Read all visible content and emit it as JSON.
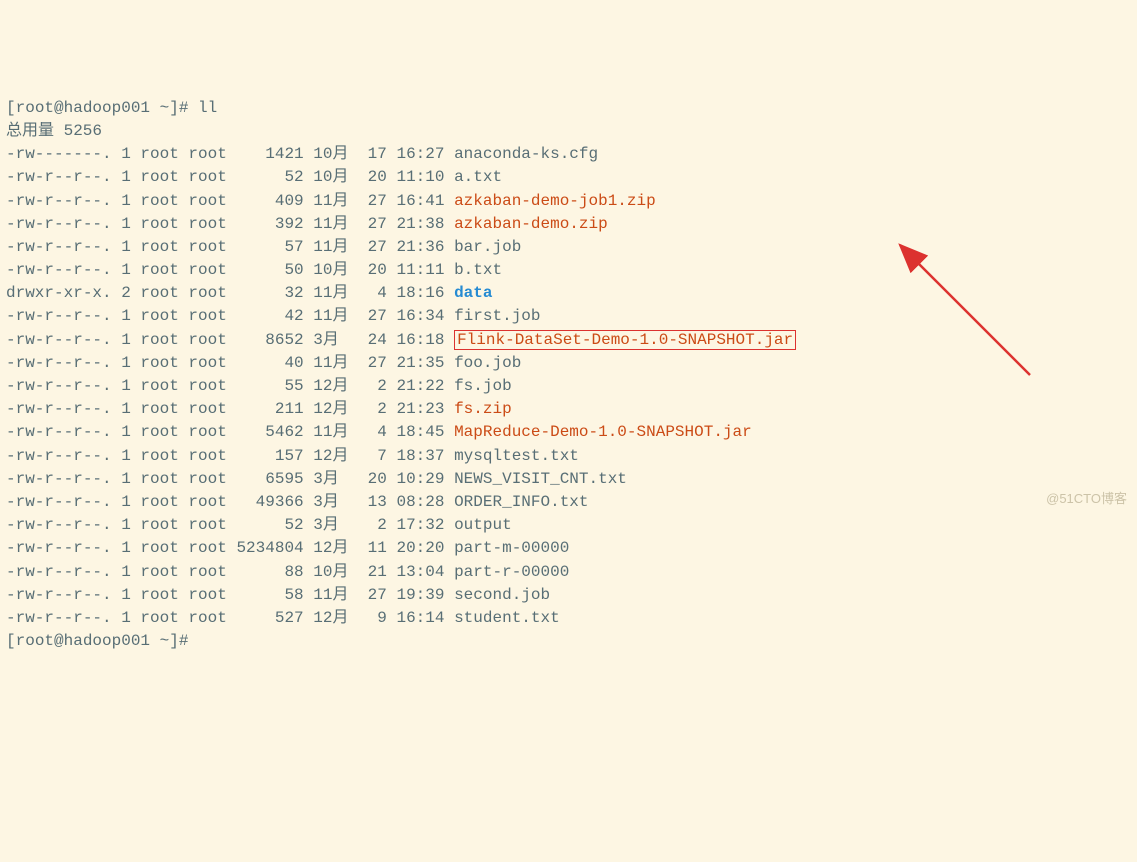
{
  "prompt": {
    "open": "[",
    "user_host": "root@hadoop001 ~",
    "close": "]#",
    "command": "ll"
  },
  "total_line": "总用量 5256",
  "rows": [
    {
      "perm": "-rw-------.",
      "links": "1",
      "owner": "root",
      "group": "root",
      "size": "1421",
      "month": "10月",
      "day": "17",
      "time": "16:27",
      "name": "anaconda-ks.cfg",
      "cls": "fname"
    },
    {
      "perm": "-rw-r--r--.",
      "links": "1",
      "owner": "root",
      "group": "root",
      "size": "52",
      "month": "10月",
      "day": "20",
      "time": "11:10",
      "name": "a.txt",
      "cls": "fname"
    },
    {
      "perm": "-rw-r--r--.",
      "links": "1",
      "owner": "root",
      "group": "root",
      "size": "409",
      "month": "11月",
      "day": "27",
      "time": "16:41",
      "name": "azkaban-demo-job1.zip",
      "cls": "fname-red"
    },
    {
      "perm": "-rw-r--r--.",
      "links": "1",
      "owner": "root",
      "group": "root",
      "size": "392",
      "month": "11月",
      "day": "27",
      "time": "21:38",
      "name": "azkaban-demo.zip",
      "cls": "fname-red"
    },
    {
      "perm": "-rw-r--r--.",
      "links": "1",
      "owner": "root",
      "group": "root",
      "size": "57",
      "month": "11月",
      "day": "27",
      "time": "21:36",
      "name": "bar.job",
      "cls": "fname"
    },
    {
      "perm": "-rw-r--r--.",
      "links": "1",
      "owner": "root",
      "group": "root",
      "size": "50",
      "month": "10月",
      "day": "20",
      "time": "11:11",
      "name": "b.txt",
      "cls": "fname"
    },
    {
      "perm": "drwxr-xr-x.",
      "links": "2",
      "owner": "root",
      "group": "root",
      "size": "32",
      "month": "11月",
      "day": "4",
      "time": "18:16",
      "name": "data",
      "cls": "fname-blue"
    },
    {
      "perm": "-rw-r--r--.",
      "links": "1",
      "owner": "root",
      "group": "root",
      "size": "42",
      "month": "11月",
      "day": "27",
      "time": "16:34",
      "name": "first.job",
      "cls": "fname"
    },
    {
      "perm": "-rw-r--r--.",
      "links": "1",
      "owner": "root",
      "group": "root",
      "size": "8652",
      "month": "3月",
      "day": "24",
      "time": "16:18",
      "name": "Flink-DataSet-Demo-1.0-SNAPSHOT.jar",
      "cls": "boxed",
      "marked": true
    },
    {
      "perm": "-rw-r--r--.",
      "links": "1",
      "owner": "root",
      "group": "root",
      "size": "40",
      "month": "11月",
      "day": "27",
      "time": "21:35",
      "name": "foo.job",
      "cls": "fname"
    },
    {
      "perm": "-rw-r--r--.",
      "links": "1",
      "owner": "root",
      "group": "root",
      "size": "55",
      "month": "12月",
      "day": "2",
      "time": "21:22",
      "name": "fs.job",
      "cls": "fname"
    },
    {
      "perm": "-rw-r--r--.",
      "links": "1",
      "owner": "root",
      "group": "root",
      "size": "211",
      "month": "12月",
      "day": "2",
      "time": "21:23",
      "name": "fs.zip",
      "cls": "fname-red"
    },
    {
      "perm": "-rw-r--r--.",
      "links": "1",
      "owner": "root",
      "group": "root",
      "size": "5462",
      "month": "11月",
      "day": "4",
      "time": "18:45",
      "name": "MapReduce-Demo-1.0-SNAPSHOT.jar",
      "cls": "fname-red"
    },
    {
      "perm": "-rw-r--r--.",
      "links": "1",
      "owner": "root",
      "group": "root",
      "size": "157",
      "month": "12月",
      "day": "7",
      "time": "18:37",
      "name": "mysqltest.txt",
      "cls": "fname"
    },
    {
      "perm": "-rw-r--r--.",
      "links": "1",
      "owner": "root",
      "group": "root",
      "size": "6595",
      "month": "3月",
      "day": "20",
      "time": "10:29",
      "name": "NEWS_VISIT_CNT.txt",
      "cls": "fname"
    },
    {
      "perm": "-rw-r--r--.",
      "links": "1",
      "owner": "root",
      "group": "root",
      "size": "49366",
      "month": "3月",
      "day": "13",
      "time": "08:28",
      "name": "ORDER_INFO.txt",
      "cls": "fname"
    },
    {
      "perm": "-rw-r--r--.",
      "links": "1",
      "owner": "root",
      "group": "root",
      "size": "52",
      "month": "3月",
      "day": "2",
      "time": "17:32",
      "name": "output",
      "cls": "fname"
    },
    {
      "perm": "-rw-r--r--.",
      "links": "1",
      "owner": "root",
      "group": "root",
      "size": "5234804",
      "month": "12月",
      "day": "11",
      "time": "20:20",
      "name": "part-m-00000",
      "cls": "fname"
    },
    {
      "perm": "-rw-r--r--.",
      "links": "1",
      "owner": "root",
      "group": "root",
      "size": "88",
      "month": "10月",
      "day": "21",
      "time": "13:04",
      "name": "part-r-00000",
      "cls": "fname"
    },
    {
      "perm": "-rw-r--r--.",
      "links": "1",
      "owner": "root",
      "group": "root",
      "size": "58",
      "month": "11月",
      "day": "27",
      "time": "19:39",
      "name": "second.job",
      "cls": "fname"
    },
    {
      "perm": "-rw-r--r--.",
      "links": "1",
      "owner": "root",
      "group": "root",
      "size": "527",
      "month": "12月",
      "day": "9",
      "time": "16:14",
      "name": "student.txt",
      "cls": "fname"
    }
  ],
  "prompt_end": {
    "open": "[",
    "user_host": "root@hadoop001 ~",
    "close": "]#"
  },
  "watermark": "@51CTO博客"
}
